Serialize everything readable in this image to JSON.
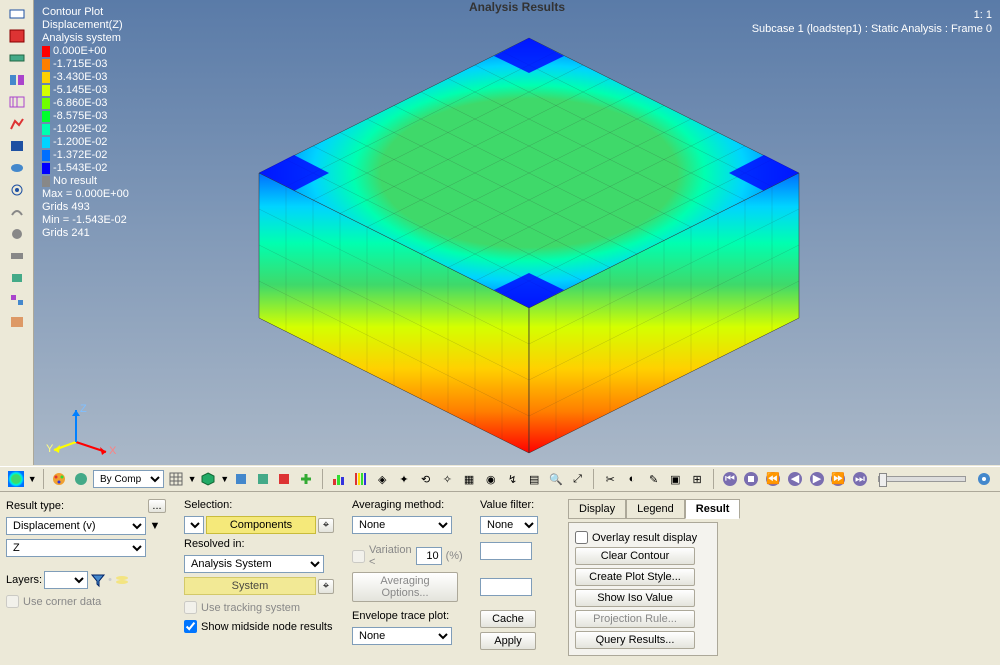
{
  "viewport": {
    "title": "Analysis Results",
    "topright_line1": "1: 1",
    "topright_line2": "Subcase 1 (loadstep1) : Static Analysis : Frame 0"
  },
  "legend": {
    "header1": "Contour Plot",
    "header2": "Displacement(Z)",
    "header3": "Analysis system",
    "items": [
      {
        "color": "#ff0000",
        "value": "0.000E+00"
      },
      {
        "color": "#ff7f00",
        "value": "-1.715E-03"
      },
      {
        "color": "#ffd000",
        "value": "-3.430E-03"
      },
      {
        "color": "#d4ff00",
        "value": "-5.145E-03"
      },
      {
        "color": "#6fff00",
        "value": "-6.860E-03"
      },
      {
        "color": "#00ff2a",
        "value": "-8.575E-03"
      },
      {
        "color": "#00ffb0",
        "value": "-1.029E-02"
      },
      {
        "color": "#00d4ff",
        "value": "-1.200E-02"
      },
      {
        "color": "#006fff",
        "value": "-1.372E-02"
      },
      {
        "color": "#0000ff",
        "value": "-1.543E-02"
      }
    ],
    "noresult_label": "No result",
    "noresult_color": "#888",
    "max_line": "Max = 0.000E+00",
    "max_grids": "Grids 493",
    "min_line": "Min = -1.543E-02",
    "min_grids": "Grids 241"
  },
  "axis": {
    "x": "X",
    "y": "Y",
    "z": "Z"
  },
  "hbar": {
    "bycomp": "By Comp"
  },
  "bottom": {
    "result_type": {
      "label": "Result type:",
      "value": "Displacement (v)",
      "component": "Z"
    },
    "layers_label": "Layers:",
    "use_corner": "Use corner data",
    "selection": {
      "label": "Selection:",
      "components_btn": "Components",
      "resolved_label": "Resolved in:",
      "resolved_value": "Analysis System",
      "system_btn": "System",
      "use_tracking": "Use tracking system",
      "show_midside": "Show midside node results"
    },
    "averaging": {
      "label": "Averaging method:",
      "value": "None",
      "variation_label": "Variation <",
      "variation_value": "10",
      "variation_unit": "(%)",
      "options_btn": "Averaging Options...",
      "envelope_label": "Envelope trace plot:",
      "envelope_value": "None"
    },
    "valuefilter": {
      "label": "Value filter:",
      "value": "None"
    },
    "cache_btn": "Cache",
    "apply_btn": "Apply",
    "tabs": {
      "display": "Display",
      "legend": "Legend",
      "result": "Result"
    },
    "result_tab": {
      "overlay": "Overlay result display",
      "clear": "Clear Contour",
      "create": "Create Plot Style...",
      "show_iso": "Show Iso Value",
      "projection": "Projection Rule...",
      "query": "Query Results..."
    }
  }
}
